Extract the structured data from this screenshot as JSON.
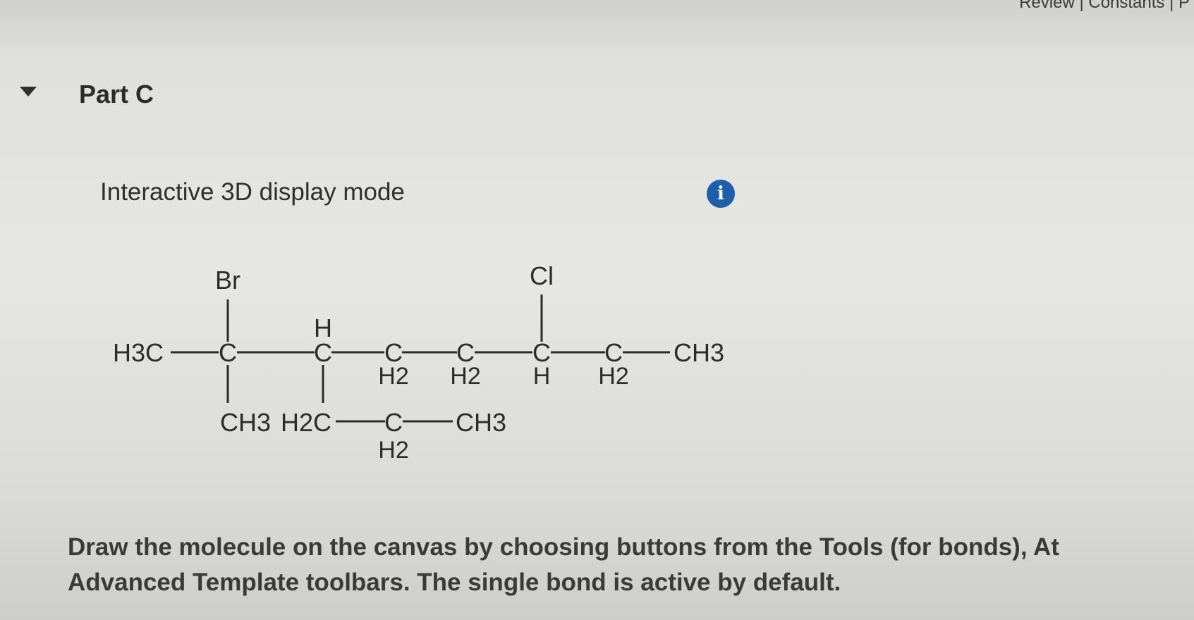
{
  "header": {
    "top_right_text": "Review | Constants | P"
  },
  "part": {
    "title": "Part C",
    "toggle_icon": "caret-down-icon"
  },
  "display_mode": {
    "label": "Interactive 3D display mode",
    "info_icon": "info-icon",
    "info_glyph": "i",
    "info_color": "#1f5ea8"
  },
  "molecule": {
    "atoms": [
      {
        "id": "H3C_left",
        "label": "H3C"
      },
      {
        "id": "Br",
        "label": "Br"
      },
      {
        "id": "C1",
        "label": "C"
      },
      {
        "id": "CH3_c1",
        "label": "CH3"
      },
      {
        "id": "H_c2",
        "label": "H"
      },
      {
        "id": "C2",
        "label": "C"
      },
      {
        "id": "H2C_branch",
        "label": "H2C"
      },
      {
        "id": "C_branch",
        "label": "C"
      },
      {
        "id": "H2_branch",
        "label": "H2"
      },
      {
        "id": "CH3_branch",
        "label": "CH3"
      },
      {
        "id": "C3",
        "label": "C"
      },
      {
        "id": "H2_c3",
        "label": "H2"
      },
      {
        "id": "C4",
        "label": "C"
      },
      {
        "id": "H2_c4",
        "label": "H2"
      },
      {
        "id": "Cl",
        "label": "Cl"
      },
      {
        "id": "C5",
        "label": "C"
      },
      {
        "id": "H_c5",
        "label": "H"
      },
      {
        "id": "C6",
        "label": "C"
      },
      {
        "id": "H2_c6",
        "label": "H2"
      },
      {
        "id": "CH3_right",
        "label": "CH3"
      }
    ]
  },
  "instructions": {
    "line1": "Draw the molecule on the canvas by choosing buttons from the Tools (for bonds), At",
    "line2": "Advanced Template toolbars. The single bond is active by default."
  }
}
